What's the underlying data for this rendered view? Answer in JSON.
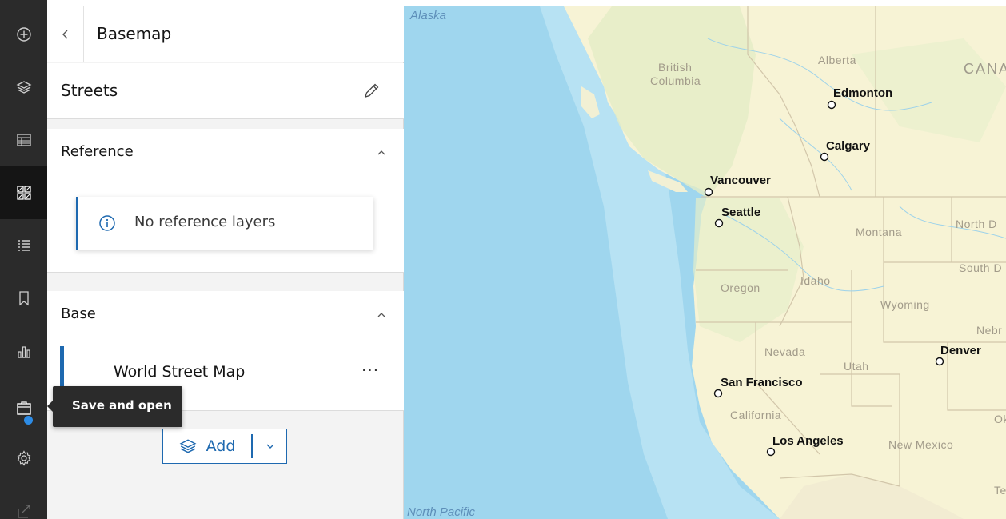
{
  "action_bar": {
    "items": [
      {
        "name": "add-icon",
        "active": false
      },
      {
        "name": "layers-icon",
        "active": false
      },
      {
        "name": "tables-icon",
        "active": false
      },
      {
        "name": "basemap-icon",
        "active": true
      },
      {
        "name": "legend-icon",
        "active": false
      },
      {
        "name": "bookmarks-icon",
        "active": false
      },
      {
        "name": "charts-icon",
        "active": false
      },
      {
        "name": "save-open-icon",
        "active": false,
        "badge": true
      },
      {
        "name": "settings-icon",
        "active": false
      },
      {
        "name": "share-icon",
        "active": false
      }
    ]
  },
  "panel": {
    "header_title": "Basemap",
    "basemap_title": "Streets",
    "reference": {
      "title": "Reference",
      "notice": "No reference layers"
    },
    "base": {
      "title": "Base",
      "layer_name": "World Street Map",
      "more_label": "···"
    },
    "add_button_label": "Add"
  },
  "tooltip": {
    "text": "Save and open"
  },
  "map": {
    "water_labels": {
      "top": "Alaska",
      "bottom": "North Pacific"
    },
    "regions": {
      "british_columbia_1": "British",
      "british_columbia_2": "Columbia",
      "alberta": "Alberta",
      "canada": "CANA",
      "montana": "Montana",
      "north_dakota": "North D",
      "south_dakota": "South D",
      "idaho": "Idaho",
      "oregon": "Oregon",
      "wyoming": "Wyoming",
      "nebraska": "Nebr",
      "nevada": "Nevada",
      "utah": "Utah",
      "california": "California",
      "new_mexico": "New Mexico",
      "oklahoma": "Ok",
      "texas": "Te"
    },
    "cities": {
      "edmonton": "Edmonton",
      "calgary": "Calgary",
      "vancouver": "Vancouver",
      "seattle": "Seattle",
      "san_francisco": "San Francisco",
      "los_angeles": "Los Angeles",
      "denver": "Denver"
    }
  },
  "colors": {
    "action_bar": "#2b2b2b",
    "accent": "#1e69b0",
    "ocean": "#9fd6ee",
    "land": "#f7f3d5"
  }
}
